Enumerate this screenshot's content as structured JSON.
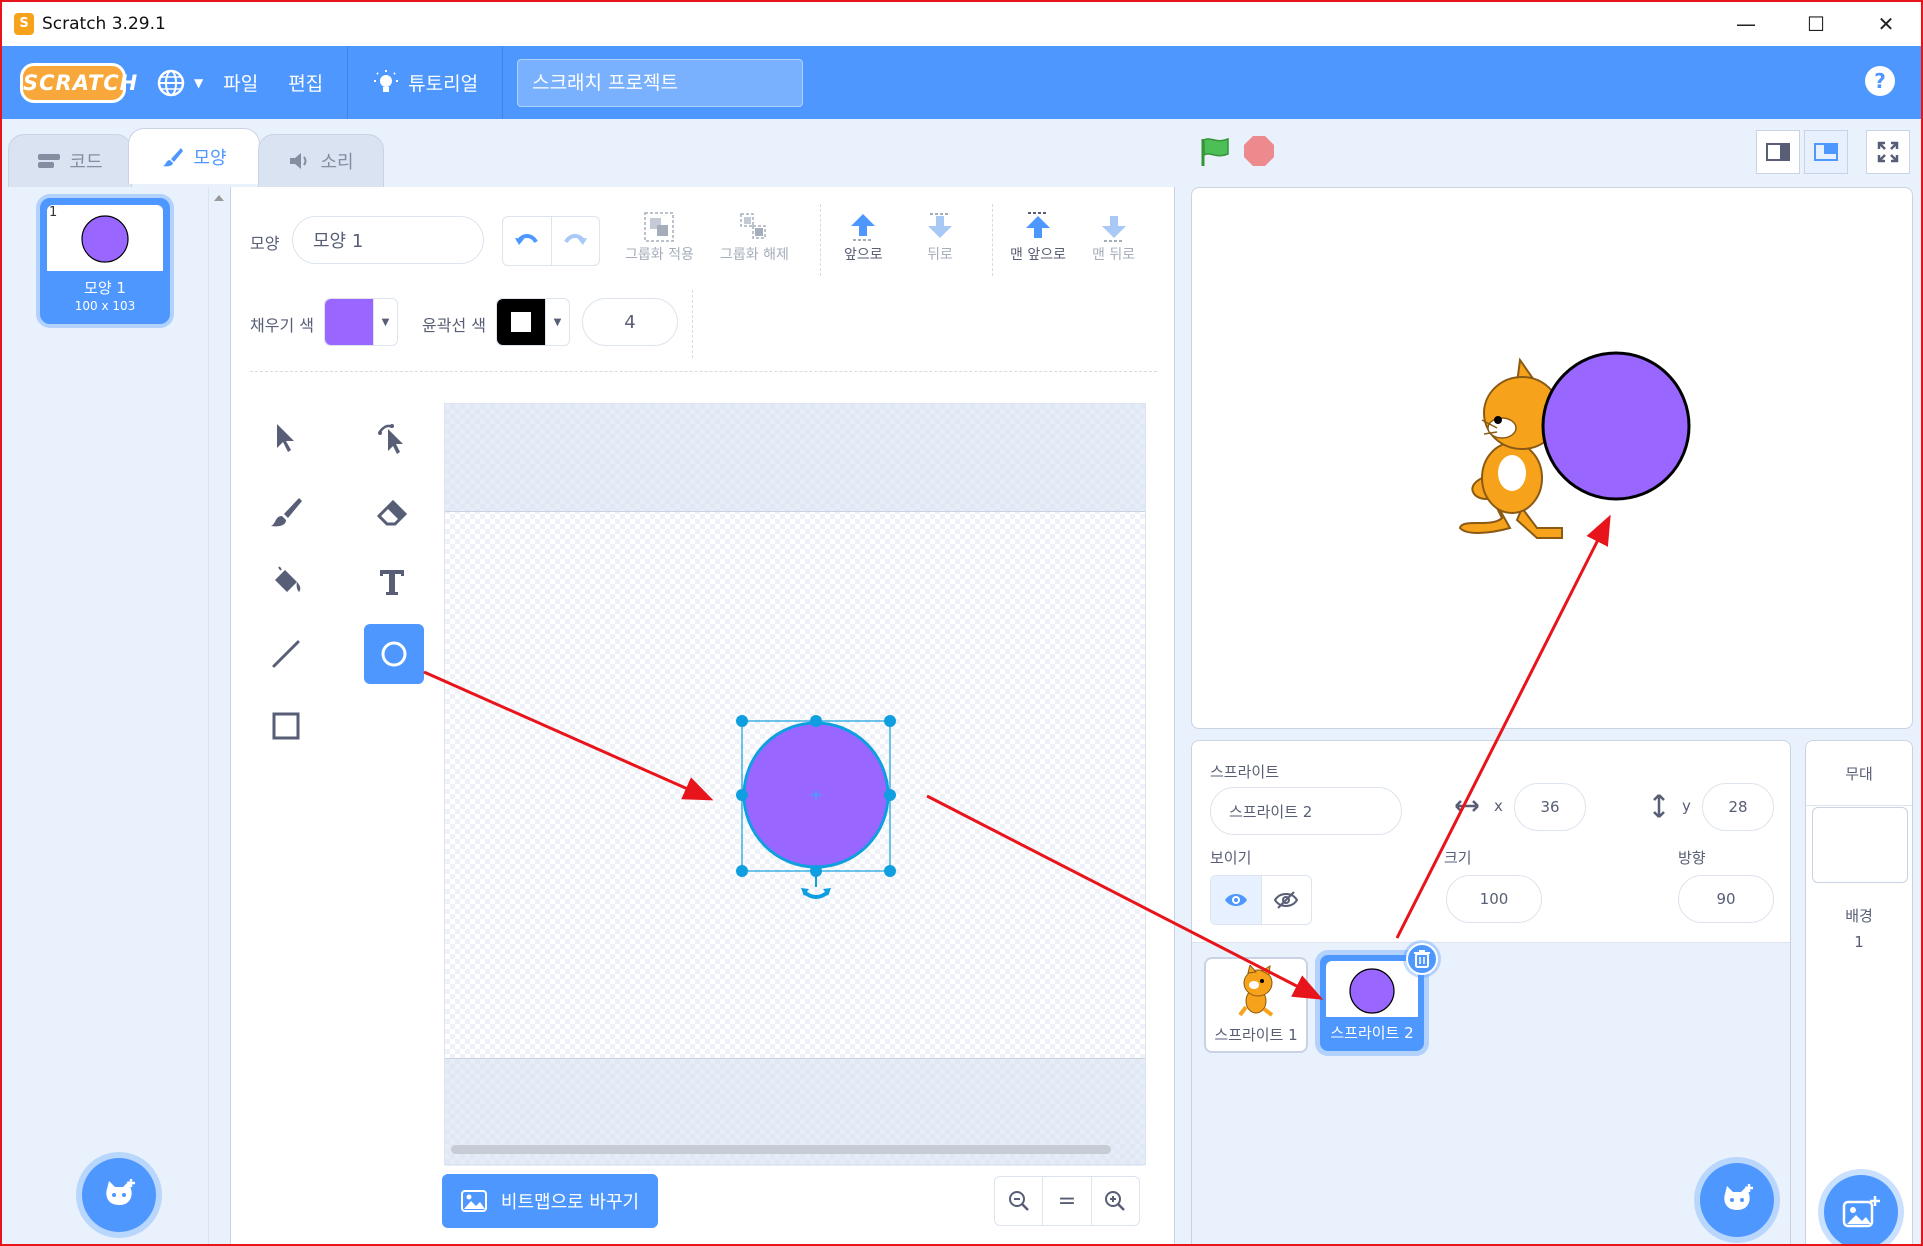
{
  "window": {
    "title": "Scratch 3.29.1",
    "minimize": "—",
    "maximize": "☐",
    "close": "✕"
  },
  "menubar": {
    "logo": "SCRATCH",
    "file": "파일",
    "edit": "편집",
    "tutorials": "튜토리얼",
    "project_title": "스크래치 프로젝트",
    "help": "?"
  },
  "tabs": {
    "code": "코드",
    "costumes": "모양",
    "sounds": "소리"
  },
  "costume_list": {
    "items": [
      {
        "number": "1",
        "name": "모양 1",
        "size": "100 x 103",
        "color": "#9966ff"
      }
    ]
  },
  "paint": {
    "costume_label": "모양",
    "costume_name": "모양 1",
    "group": "그룹화 적용",
    "ungroup": "그룹화 해제",
    "forward": "앞으로",
    "backward": "뒤로",
    "front": "맨 앞으로",
    "back": "맨 뒤로",
    "fill_label": "채우기 색",
    "fill_color": "#9966ff",
    "outline_label": "윤곽선 색",
    "outline_color": "#000000",
    "outline_width": "4",
    "bitmap_button": "비트맵으로 바꾸기",
    "zoom_reset": "="
  },
  "sprite_info": {
    "sprite_label": "스프라이트",
    "sprite_name": "스프라이트 2",
    "x_label": "x",
    "x_value": "36",
    "y_label": "y",
    "y_value": "28",
    "show_label": "보이기",
    "size_label": "크기",
    "size_value": "100",
    "direction_label": "방향",
    "direction_value": "90"
  },
  "sprites": [
    {
      "name": "스프라이트 1",
      "selected": false
    },
    {
      "name": "스프라이트 2",
      "selected": true
    }
  ],
  "stage_pane": {
    "title": "무대",
    "backdrops_label": "배경",
    "backdrops_count": "1"
  },
  "colors": {
    "accent": "#4d97ff",
    "annotation": "#e8141b",
    "sprite_fill": "#9966ff"
  }
}
